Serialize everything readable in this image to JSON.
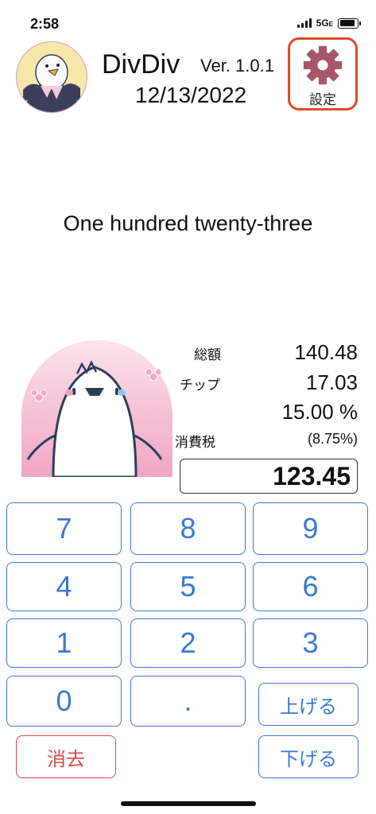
{
  "status_bar": {
    "time": "2:58",
    "network": "5G",
    "network_suffix": "E"
  },
  "header": {
    "app_name": "DivDiv",
    "version": "Ver. 1.0.1",
    "date": "12/13/2022",
    "settings_label": "設定",
    "settings_icon": "gear-icon",
    "avatar_icon": "eagle-avatar"
  },
  "amount_words": "One hundred twenty-three",
  "mascot_icon": "bird-mascot",
  "summary": {
    "total_label": "総額",
    "total_value": "140.48",
    "tip_label": "チップ",
    "tip_value": "17.03",
    "tip_percent": "15.00 %",
    "tax_label": "消費税",
    "tax_rate": "(8.75%)"
  },
  "amount_input": "123.45",
  "keypad": {
    "k7": "7",
    "k8": "8",
    "k9": "9",
    "k4": "4",
    "k5": "5",
    "k6": "6",
    "k1": "1",
    "k2": "2",
    "k3": "3",
    "k0": "0",
    "dot": ".",
    "up": "上げる",
    "down": "下げる",
    "clear": "消去"
  },
  "colors": {
    "key_border": "#3e78d6",
    "key_text": "#3a78d9",
    "clear_color": "#d94a4a",
    "settings_border": "#e04a2a",
    "gear_color": "#a8566a"
  }
}
